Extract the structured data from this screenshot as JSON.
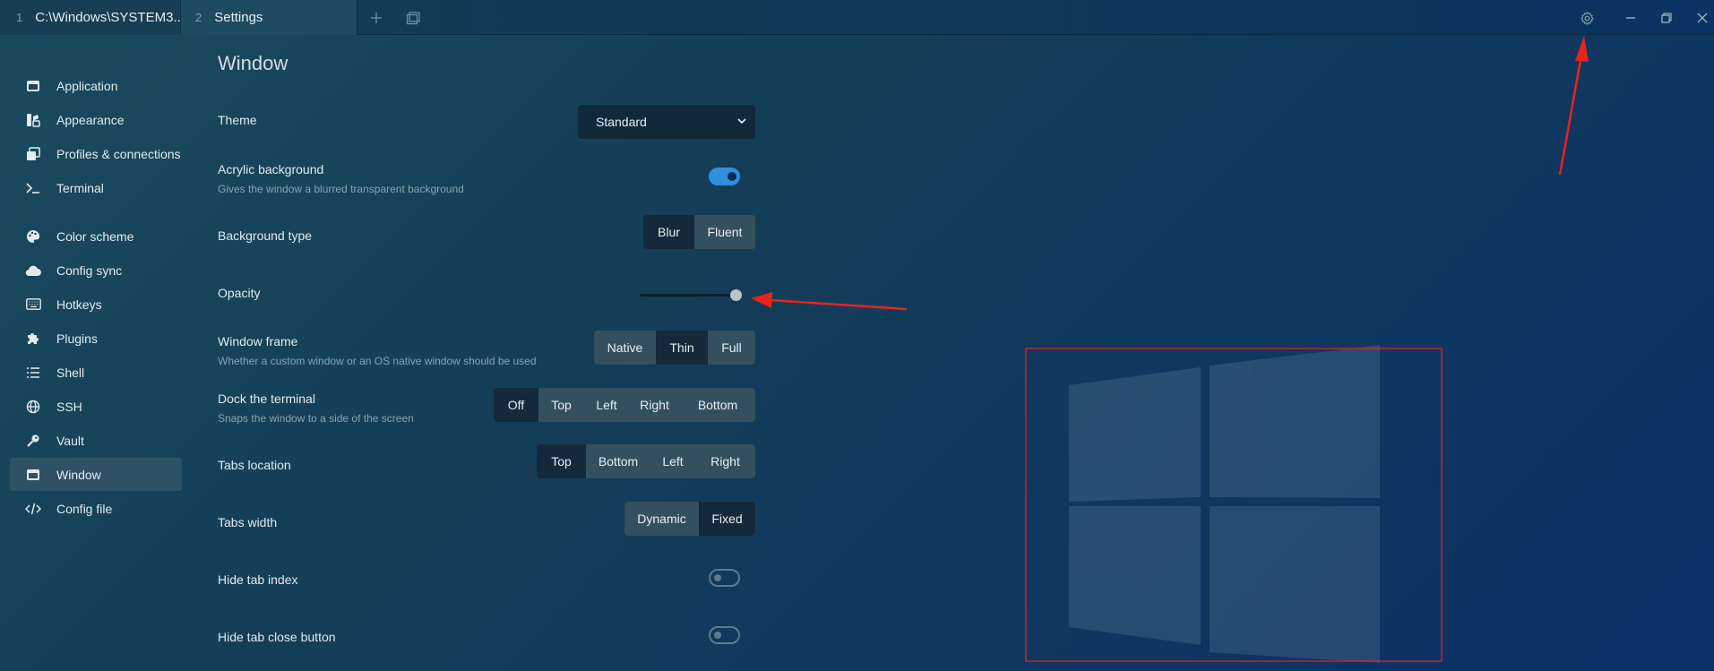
{
  "tabs": [
    {
      "index": "1",
      "title": "C:\\Windows\\SYSTEM3..."
    },
    {
      "index": "2",
      "title": "Settings"
    }
  ],
  "titlebar_icons": [
    "plus-icon",
    "layers-icon",
    "gear-icon",
    "minimize-icon",
    "restore-icon",
    "close-icon"
  ],
  "sidebar": {
    "items": [
      {
        "label": "Application",
        "icon": "window-icon"
      },
      {
        "label": "Appearance",
        "icon": "palette-grid-icon"
      },
      {
        "label": "Profiles & connections",
        "icon": "profiles-icon"
      },
      {
        "label": "Terminal",
        "icon": "terminal-prompt-icon"
      },
      {
        "label": "Color scheme",
        "icon": "palette-icon"
      },
      {
        "label": "Config sync",
        "icon": "cloud-icon"
      },
      {
        "label": "Hotkeys",
        "icon": "keyboard-icon"
      },
      {
        "label": "Plugins",
        "icon": "puzzle-icon"
      },
      {
        "label": "Shell",
        "icon": "list-icon"
      },
      {
        "label": "SSH",
        "icon": "globe-icon"
      },
      {
        "label": "Vault",
        "icon": "key-icon"
      },
      {
        "label": "Window",
        "icon": "window-icon",
        "active": true
      },
      {
        "label": "Config file",
        "icon": "code-icon"
      }
    ]
  },
  "main": {
    "title": "Window",
    "theme": {
      "label": "Theme",
      "value": "Standard"
    },
    "acrylic": {
      "label": "Acrylic background",
      "desc": "Gives the window a blurred transparent background",
      "on": true
    },
    "background_type": {
      "label": "Background type",
      "options": [
        "Blur",
        "Fluent"
      ],
      "selected": "Blur"
    },
    "opacity": {
      "label": "Opacity",
      "value": 0.95
    },
    "window_frame": {
      "label": "Window frame",
      "desc": "Whether a custom window or an OS native window should be used",
      "options": [
        "Native",
        "Thin",
        "Full"
      ],
      "selected": "Thin"
    },
    "dock": {
      "label": "Dock the terminal",
      "desc": "Snaps the window to a side of the screen",
      "options": [
        "Off",
        "Top",
        "Left",
        "Right",
        "Bottom"
      ],
      "selected": "Off"
    },
    "tabs_location": {
      "label": "Tabs location",
      "options": [
        "Top",
        "Bottom",
        "Left",
        "Right"
      ],
      "selected": "Top"
    },
    "tabs_width": {
      "label": "Tabs width",
      "options": [
        "Dynamic",
        "Fixed"
      ],
      "selected": "Fixed"
    },
    "hide_tab_index": {
      "label": "Hide tab index",
      "on": false
    },
    "hide_tab_close": {
      "label": "Hide tab close button",
      "on": false
    }
  },
  "colors": {
    "accent": "#2f8ee0",
    "annotation": "#e8231c"
  }
}
